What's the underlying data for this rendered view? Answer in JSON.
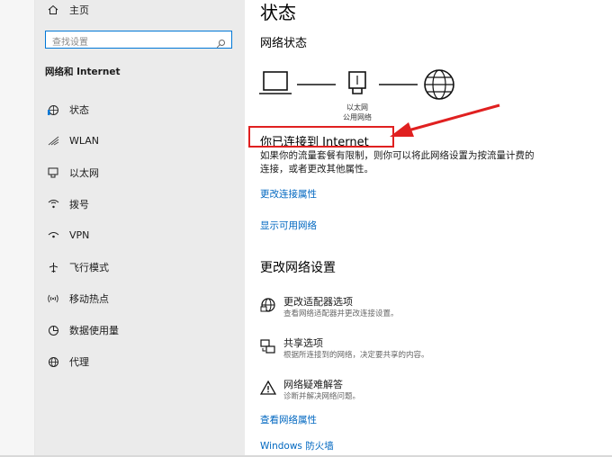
{
  "sidebar": {
    "home_label": "主页",
    "search_placeholder": "查找设置",
    "section_title": "网络和 Internet",
    "items": [
      {
        "label": "状态",
        "icon": "home-globe-icon"
      },
      {
        "label": "WLAN",
        "icon": "wifi-icon"
      },
      {
        "label": "以太网",
        "icon": "ethernet-icon"
      },
      {
        "label": "拨号",
        "icon": "dialup-icon"
      },
      {
        "label": "VPN",
        "icon": "vpn-icon"
      },
      {
        "label": "飞行模式",
        "icon": "airplane-icon"
      },
      {
        "label": "移动热点",
        "icon": "hotspot-icon"
      },
      {
        "label": "数据使用量",
        "icon": "data-usage-icon"
      },
      {
        "label": "代理",
        "icon": "proxy-globe-icon"
      }
    ]
  },
  "main": {
    "title": "状态",
    "network_status": "网络状态",
    "diagram": {
      "ethernet_label_line1": "以太网",
      "ethernet_label_line2": "公用网络"
    },
    "connected_text": "你已连接到 Internet",
    "description": "如果你的流量套餐有限制，则你可以将此网络设置为按流量计费的连接，或者更改其他属性。",
    "links": {
      "change_properties": "更改连接属性",
      "show_networks": "显示可用网络",
      "view_properties": "查看网络属性",
      "firewall": "Windows 防火墙"
    },
    "change_settings_title": "更改网络设置",
    "options": [
      {
        "title": "更改适配器选项",
        "desc": "查看网络适配器并更改连接设置。",
        "icon": "adapter-globe-icon"
      },
      {
        "title": "共享选项",
        "desc": "根据所连接到的网络，决定要共享的内容。",
        "icon": "sharing-icon"
      },
      {
        "title": "网络疑难解答",
        "desc": "诊断并解决网络问题。",
        "icon": "warning-icon"
      }
    ]
  },
  "colors": {
    "accent": "#0067c0",
    "highlight": "#e02020",
    "sidebar_bg": "#ebebeb"
  }
}
